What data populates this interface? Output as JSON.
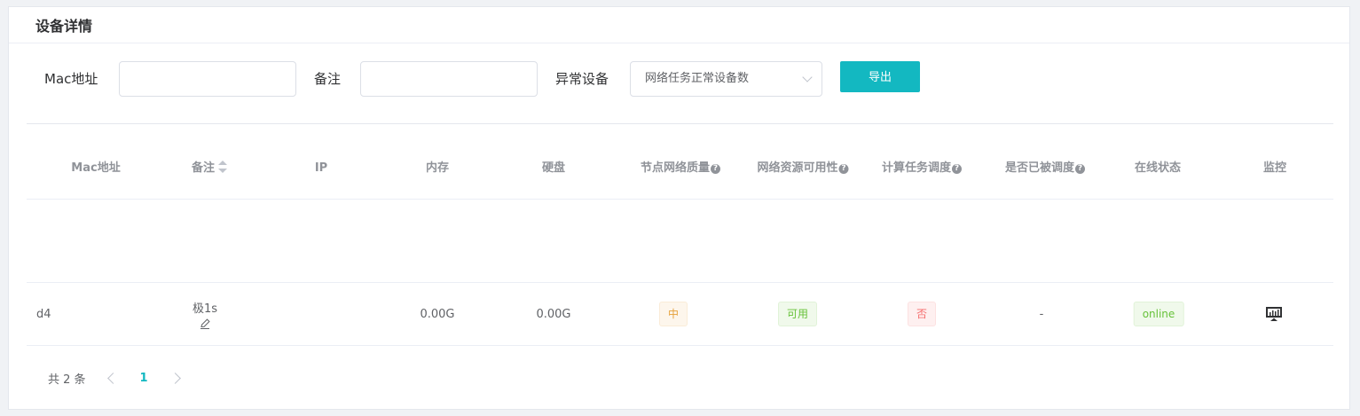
{
  "header": {
    "title": "设备详情"
  },
  "filters": {
    "mac_label": "Mac地址",
    "mac_value": "",
    "note_label": "备注",
    "note_value": "",
    "abnormal_label": "异常设备",
    "abnormal_selected": "网络任务正常设备数",
    "export_label": "导出"
  },
  "table": {
    "columns": {
      "mac": "Mac地址",
      "note": "备注",
      "ip": "IP",
      "memory": "内存",
      "disk": "硬盘",
      "node_quality": "节点网络质量",
      "resource_avail": "网络资源可用性",
      "task_schedule": "计算任务调度",
      "scheduled": "是否已被调度",
      "online_status": "在线状态",
      "monitor": "监控"
    },
    "rows": [
      {
        "mac": "d4",
        "note": "极1s",
        "ip": "",
        "memory": "0.00G",
        "disk": "0.00G",
        "node_quality": "中",
        "resource_avail": "可用",
        "task_schedule": "否",
        "scheduled": "-",
        "online_status": "online"
      }
    ]
  },
  "pagination": {
    "total_text": "共 2 条",
    "current_page": "1"
  },
  "colors": {
    "accent": "#13b8c1",
    "warn": "#e6a23c",
    "success": "#67c23a",
    "danger": "#f56c6c"
  }
}
